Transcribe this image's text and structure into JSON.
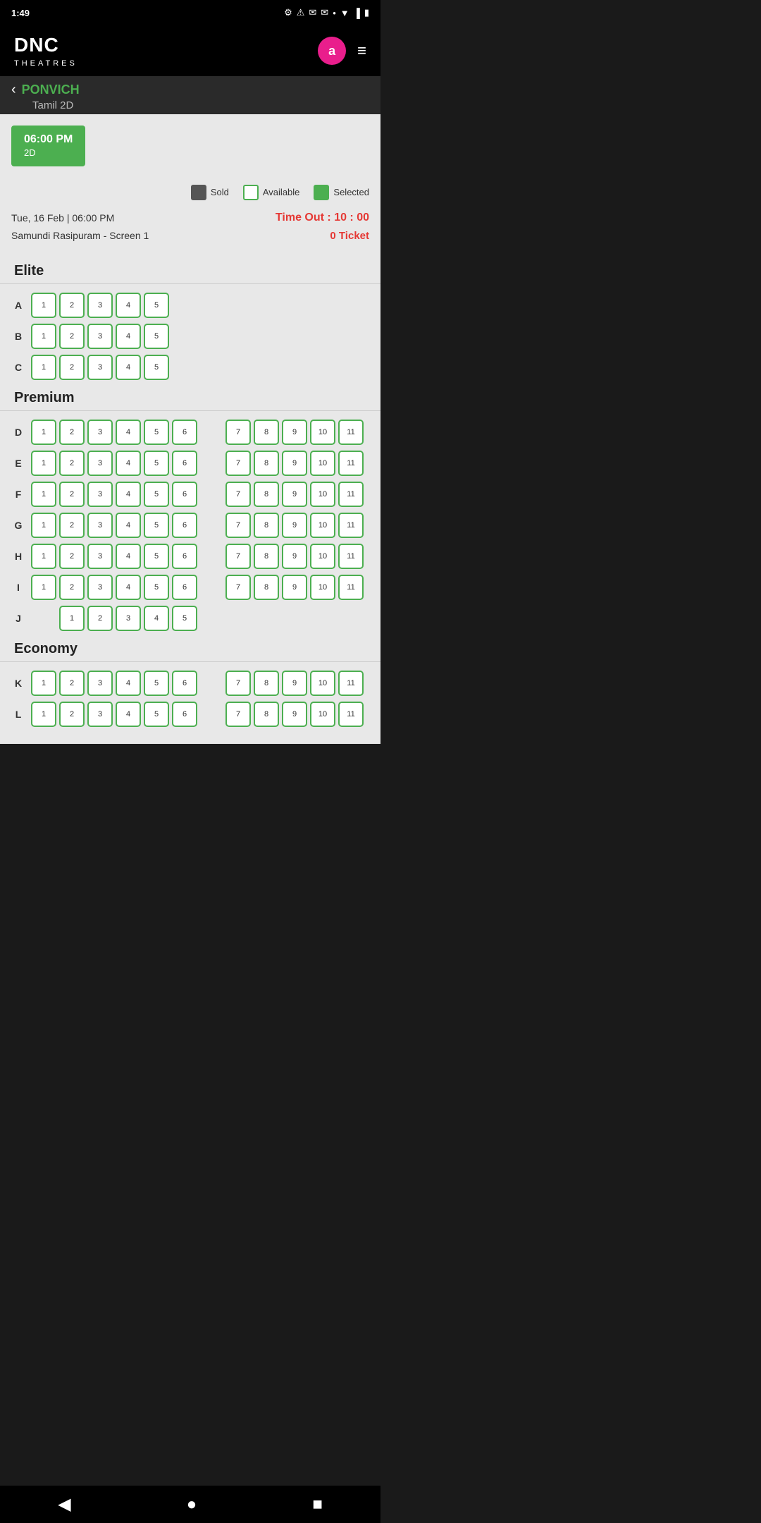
{
  "statusBar": {
    "time": "1:49",
    "icons": [
      "settings",
      "warning",
      "email",
      "email2",
      "dot"
    ]
  },
  "header": {
    "logoMain": "DNC",
    "logoSub": "THEATRES",
    "avatarLetter": "a",
    "menuLabel": "≡"
  },
  "backBar": {
    "movieTitle": "PONVICH",
    "language": "Tamil 2D"
  },
  "timeSlot": {
    "time": "06:00 PM",
    "format": "2D"
  },
  "legend": {
    "soldLabel": "Sold",
    "availableLabel": "Available",
    "selectedLabel": "Selected"
  },
  "infoRow": {
    "date": "Tue, 16 Feb | 06:00 PM",
    "timeout": "Time Out : 10 : 00"
  },
  "venueRow": {
    "venue": "Samundi Rasipuram - Screen 1",
    "tickets": "0 Ticket"
  },
  "sections": [
    {
      "name": "Elite",
      "rows": [
        {
          "label": "A",
          "seats": [
            1,
            2,
            3,
            4,
            5
          ],
          "gap": false,
          "extraSeats": []
        },
        {
          "label": "B",
          "seats": [
            1,
            2,
            3,
            4,
            5
          ],
          "gap": false,
          "extraSeats": []
        },
        {
          "label": "C",
          "seats": [
            1,
            2,
            3,
            4,
            5
          ],
          "gap": false,
          "extraSeats": []
        }
      ]
    },
    {
      "name": "Premium",
      "rows": [
        {
          "label": "D",
          "seats": [
            1,
            2,
            3,
            4,
            5,
            6
          ],
          "gap": true,
          "extraSeats": [
            7,
            8,
            9,
            10,
            11
          ]
        },
        {
          "label": "E",
          "seats": [
            1,
            2,
            3,
            4,
            5,
            6
          ],
          "gap": true,
          "extraSeats": [
            7,
            8,
            9,
            10,
            11
          ]
        },
        {
          "label": "F",
          "seats": [
            1,
            2,
            3,
            4,
            5,
            6
          ],
          "gap": true,
          "extraSeats": [
            7,
            8,
            9,
            10,
            11
          ]
        },
        {
          "label": "G",
          "seats": [
            1,
            2,
            3,
            4,
            5,
            6
          ],
          "gap": true,
          "extraSeats": [
            7,
            8,
            9,
            10,
            11
          ]
        },
        {
          "label": "H",
          "seats": [
            1,
            2,
            3,
            4,
            5,
            6
          ],
          "gap": true,
          "extraSeats": [
            7,
            8,
            9,
            10,
            11
          ]
        },
        {
          "label": "I",
          "seats": [
            1,
            2,
            3,
            4,
            5,
            6
          ],
          "gap": true,
          "extraSeats": [
            7,
            8,
            9,
            10,
            11
          ]
        },
        {
          "label": "J",
          "seats": [],
          "gap": true,
          "extraSeats": [
            1,
            2,
            3,
            4,
            5
          ]
        }
      ]
    },
    {
      "name": "Economy",
      "rows": [
        {
          "label": "K",
          "seats": [
            1,
            2,
            3,
            4,
            5,
            6
          ],
          "gap": true,
          "extraSeats": [
            7,
            8,
            9,
            10,
            11
          ]
        },
        {
          "label": "L",
          "seats": [
            1,
            2,
            3,
            4,
            5,
            6
          ],
          "gap": true,
          "extraSeats": [
            7,
            8,
            9,
            10,
            11
          ]
        }
      ]
    }
  ],
  "navBar": {
    "backIcon": "◀",
    "homeIcon": "●",
    "squareIcon": "■"
  }
}
